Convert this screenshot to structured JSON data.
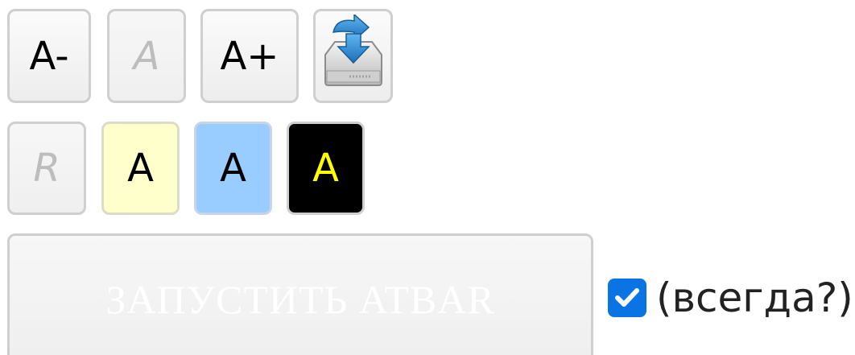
{
  "toolbar": {
    "decrease_label": "A-",
    "reset_label": "A",
    "increase_label": "A+",
    "save_icon": "save-tray-icon"
  },
  "schemes": {
    "reset_label": "R",
    "yellow_label": "A",
    "blue_label": "A",
    "black_label": "A"
  },
  "launch": {
    "label": "ЗАПУСТИТЬ ATBAR",
    "always_label": "(всегда?)",
    "always_checked": true
  },
  "colors": {
    "yellow_scheme": "#ffffcc",
    "blue_scheme": "#99ccff",
    "black_scheme": "#000000",
    "black_scheme_text": "#ffff00",
    "checkbox": "#0b74e5"
  }
}
